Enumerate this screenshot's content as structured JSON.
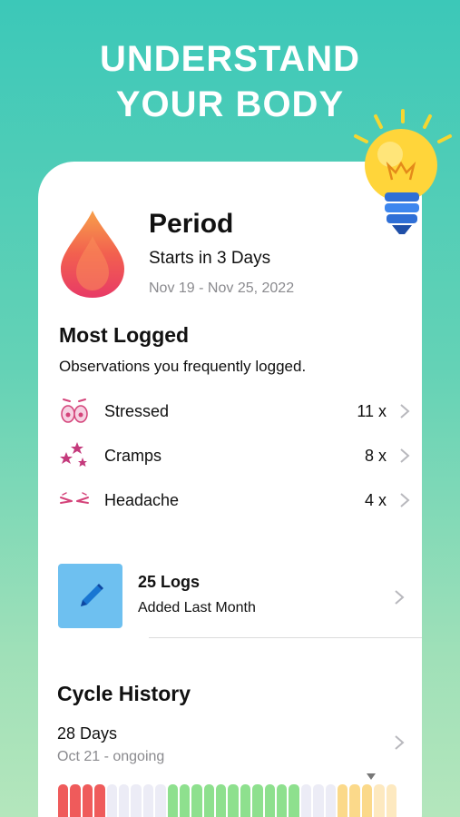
{
  "headline": {
    "line1": "UNDERSTAND",
    "line2": "YOUR BODY"
  },
  "period": {
    "title": "Period",
    "subtitle": "Starts in 3 Days",
    "dates": "Nov 19 - Nov 25, 2022"
  },
  "most_logged": {
    "title": "Most Logged",
    "description": "Observations you frequently logged.",
    "items": [
      {
        "label": "Stressed",
        "count": "11 x",
        "icon": "stressed-face-icon"
      },
      {
        "label": "Cramps",
        "count": "8 x",
        "icon": "cramps-stars-icon"
      },
      {
        "label": "Headache",
        "count": "4 x",
        "icon": "headache-eyes-icon"
      }
    ]
  },
  "logs": {
    "title": "25 Logs",
    "subtitle": "Added Last Month",
    "icon": "pencil-icon"
  },
  "cycle_history": {
    "title": "Cycle History",
    "length": "28 Days",
    "range": "Oct 21 - ongoing",
    "colors": {
      "period": "#ef5b5b",
      "neutral": "#ececf6",
      "fertile": "#8ee08e",
      "ovulation": "#fbd98a",
      "ovulation_light": "#fde9c0"
    }
  },
  "colors": {
    "accent": "#3cc8b8",
    "logs_box": "#6ec0f0"
  }
}
